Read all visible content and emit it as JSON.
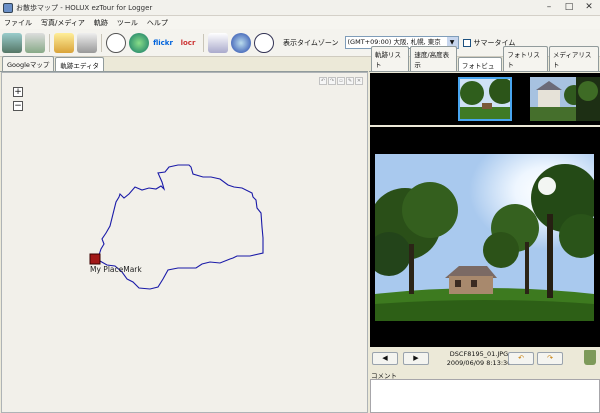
{
  "window": {
    "title": "お散歩マップ - HOLUX ezTour for Logger"
  },
  "menu": [
    "ファイル",
    "写真/メディア",
    "軌跡",
    "ツール",
    "ヘルプ"
  ],
  "toolbar": {
    "timezone_label": "表示タイムゾーン",
    "timezone_value": "(GMT+09:00) 大阪, 札幌, 東京",
    "dst_label": "サマータイム",
    "flickr_label": "flickr",
    "locr_label": "locr"
  },
  "left_tabs": [
    "Googleマップ",
    "軌跡エディタ"
  ],
  "right_tabs": [
    "軌跡リスト",
    "速度/高度表示",
    "フォトビュー",
    "フォトリスト",
    "メディアリスト"
  ],
  "map": {
    "placemark_label": "My PlaceMark"
  },
  "photo": {
    "filename": "DSCF8195_01.JPG",
    "datetime": "2009/06/09 8:13:36"
  },
  "comment_label": "コメント",
  "colors": {
    "track": "#1a1aa8",
    "selection": "#49a6f0"
  }
}
